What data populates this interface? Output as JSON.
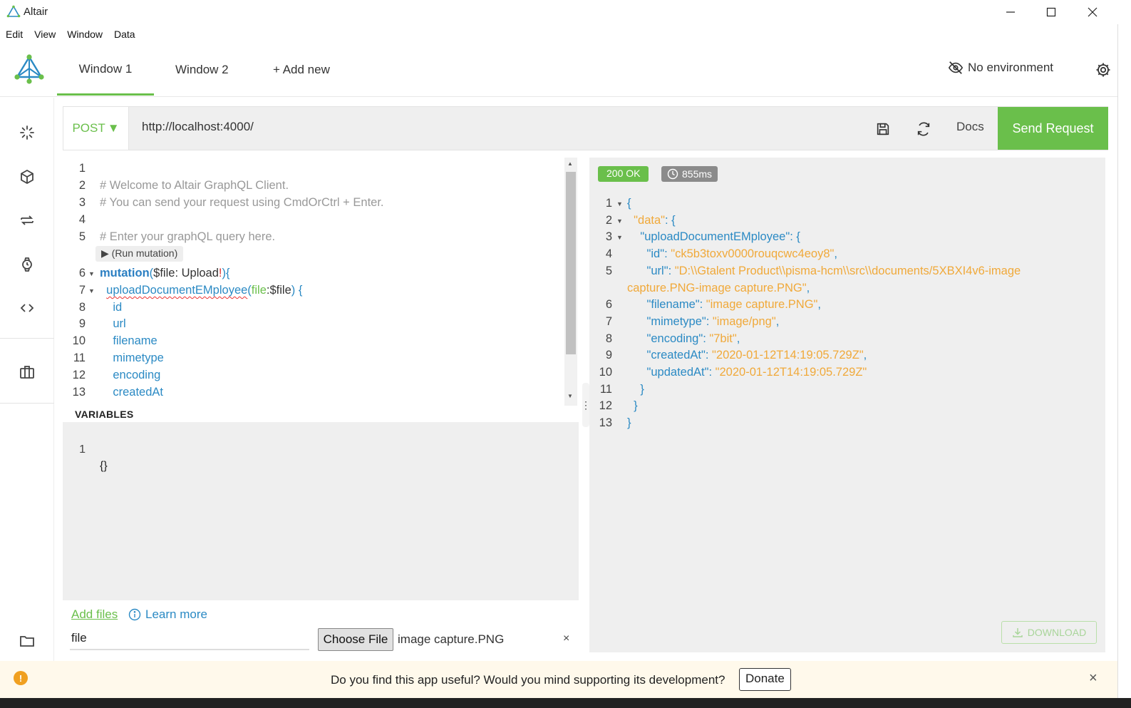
{
  "window": {
    "title": "Altair",
    "min_icon": "minimize-icon",
    "max_icon": "maximize-icon",
    "close_icon": "close-icon"
  },
  "menu": [
    "Edit",
    "View",
    "Window",
    "Data"
  ],
  "tabs": [
    {
      "label": "Window 1",
      "active": true
    },
    {
      "label": "Window 2",
      "active": false
    },
    {
      "label": "+ Add new",
      "active": false
    }
  ],
  "environment": {
    "label": "No environment",
    "icon": "eye-off-icon"
  },
  "sidebar": {
    "icons": [
      "loading-spinner-icon",
      "cube-icon",
      "swap-icon",
      "watch-icon",
      "code-icon",
      "briefcase-icon",
      "folder-icon"
    ]
  },
  "request": {
    "method": "POST",
    "url": "http://localhost:4000/",
    "docs_label": "Docs",
    "send_label": "Send Request"
  },
  "query_lines": [
    {
      "n": "1",
      "fold": "",
      "html": ""
    },
    {
      "n": "2",
      "fold": "",
      "html": "<span class=\"c-comment\"># Welcome to Altair GraphQL Client.</span>"
    },
    {
      "n": "3",
      "fold": "",
      "html": "<span class=\"c-comment\"># You can send your request using CmdOrCtrl + Enter.</span>"
    },
    {
      "n": "4",
      "fold": "",
      "html": ""
    },
    {
      "n": "5",
      "fold": "",
      "html": "<span class=\"c-comment\"># Enter your graphQL query here.</span>"
    },
    {
      "n": "6",
      "fold": "▼",
      "html": "<span class=\"c-kw\">mutation</span><span class=\"c-blue\">(</span><span class=\"c-dark\">$file: Upload</span><span class=\"c-red\">!</span><span class=\"c-blue\">){</span>"
    },
    {
      "n": "7",
      "fold": "▼",
      "html": "  <span class=\"c-blue squiggle\">uploadDocumentEMployee</span><span class=\"c-blue\">(</span><span class=\"c-green\">file</span><span class=\"c-dark\">:$file</span><span class=\"c-blue\">) {</span>"
    },
    {
      "n": "8",
      "fold": "",
      "html": "    <span class=\"c-blue\">id</span>"
    },
    {
      "n": "9",
      "fold": "",
      "html": "    <span class=\"c-blue\">url</span>"
    },
    {
      "n": "10",
      "fold": "",
      "html": "    <span class=\"c-blue\">filename</span>"
    },
    {
      "n": "11",
      "fold": "",
      "html": "    <span class=\"c-blue\">mimetype</span>"
    },
    {
      "n": "12",
      "fold": "",
      "html": "    <span class=\"c-blue\">encoding</span>"
    },
    {
      "n": "13",
      "fold": "",
      "html": "    <span class=\"c-blue\">createdAt</span>"
    }
  ],
  "run_mutation_label": "▶ (Run mutation)",
  "variables": {
    "title": "VARIABLES",
    "line_number": "1",
    "content": "{}"
  },
  "files": {
    "add_files": "Add files",
    "learn_more": "Learn more",
    "file_var": "file",
    "choose_label": "Choose File",
    "chosen": "image capture.PNG",
    "remove": "×"
  },
  "response": {
    "status": "200 OK",
    "time": "855ms",
    "lines": [
      {
        "n": "1",
        "fold": "▼",
        "html": "<span class=\"p\">{</span>"
      },
      {
        "n": "2",
        "fold": "▼",
        "html": "  <span class=\"s\">\"data\"</span><span class=\"p\">: {</span>"
      },
      {
        "n": "3",
        "fold": "▼",
        "html": "    <span class=\"k\">\"uploadDocumentEMployee\"</span><span class=\"p\">: {</span>"
      },
      {
        "n": "4",
        "fold": "",
        "html": "      <span class=\"k\">\"id\"</span><span class=\"p\">: </span><span class=\"s\">\"ck5b3toxv0000rouqcwc4eoy8\"</span><span class=\"p\">,</span>"
      },
      {
        "n": "5",
        "fold": "",
        "html": "      <span class=\"k\">\"url\"</span><span class=\"p\">: </span><span class=\"s\">\"D:\\\\Gtalent Product\\\\pisma-hcm\\\\src\\\\documents/5XBXI4v6-image</span>"
      },
      {
        "n": "",
        "fold": "",
        "html": "<span class=\"s\">capture.PNG-image capture.PNG\"</span><span class=\"p\">,</span>"
      },
      {
        "n": "6",
        "fold": "",
        "html": "      <span class=\"k\">\"filename\"</span><span class=\"p\">: </span><span class=\"s\">\"image capture.PNG\"</span><span class=\"p\">,</span>"
      },
      {
        "n": "7",
        "fold": "",
        "html": "      <span class=\"k\">\"mimetype\"</span><span class=\"p\">: </span><span class=\"s\">\"image/png\"</span><span class=\"p\">,</span>"
      },
      {
        "n": "8",
        "fold": "",
        "html": "      <span class=\"k\">\"encoding\"</span><span class=\"p\">: </span><span class=\"s\">\"7bit\"</span><span class=\"p\">,</span>"
      },
      {
        "n": "9",
        "fold": "",
        "html": "      <span class=\"k\">\"createdAt\"</span><span class=\"p\">: </span><span class=\"s\">\"2020-01-12T14:19:05.729Z\"</span><span class=\"p\">,</span>"
      },
      {
        "n": "10",
        "fold": "",
        "html": "      <span class=\"k\">\"updatedAt\"</span><span class=\"p\">: </span><span class=\"s\">\"2020-01-12T14:19:05.729Z\"</span>"
      },
      {
        "n": "11",
        "fold": "",
        "html": "    <span class=\"p\">}</span>"
      },
      {
        "n": "12",
        "fold": "",
        "html": "  <span class=\"p\">}</span>"
      },
      {
        "n": "13",
        "fold": "",
        "html": "<span class=\"p\">}</span>"
      }
    ],
    "download_label": "DOWNLOAD"
  },
  "banner": {
    "message": "Do you find this app useful? Would you mind supporting its development?",
    "donate_label": "Donate",
    "info_symbol": "!",
    "close": "×"
  },
  "colors": {
    "accent": "#6abf4b",
    "link": "#2b8ac4",
    "string": "#f0a93a"
  }
}
